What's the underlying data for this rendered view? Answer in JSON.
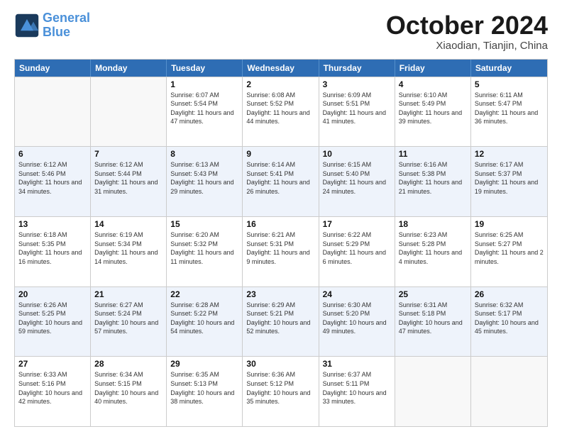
{
  "header": {
    "logo_line1": "General",
    "logo_line2": "Blue",
    "month": "October 2024",
    "location": "Xiaodian, Tianjin, China"
  },
  "days_of_week": [
    "Sunday",
    "Monday",
    "Tuesday",
    "Wednesday",
    "Thursday",
    "Friday",
    "Saturday"
  ],
  "rows": [
    {
      "alt": false,
      "cells": [
        {
          "day": "",
          "info": ""
        },
        {
          "day": "",
          "info": ""
        },
        {
          "day": "1",
          "info": "Sunrise: 6:07 AM\nSunset: 5:54 PM\nDaylight: 11 hours and 47 minutes."
        },
        {
          "day": "2",
          "info": "Sunrise: 6:08 AM\nSunset: 5:52 PM\nDaylight: 11 hours and 44 minutes."
        },
        {
          "day": "3",
          "info": "Sunrise: 6:09 AM\nSunset: 5:51 PM\nDaylight: 11 hours and 41 minutes."
        },
        {
          "day": "4",
          "info": "Sunrise: 6:10 AM\nSunset: 5:49 PM\nDaylight: 11 hours and 39 minutes."
        },
        {
          "day": "5",
          "info": "Sunrise: 6:11 AM\nSunset: 5:47 PM\nDaylight: 11 hours and 36 minutes."
        }
      ]
    },
    {
      "alt": true,
      "cells": [
        {
          "day": "6",
          "info": "Sunrise: 6:12 AM\nSunset: 5:46 PM\nDaylight: 11 hours and 34 minutes."
        },
        {
          "day": "7",
          "info": "Sunrise: 6:12 AM\nSunset: 5:44 PM\nDaylight: 11 hours and 31 minutes."
        },
        {
          "day": "8",
          "info": "Sunrise: 6:13 AM\nSunset: 5:43 PM\nDaylight: 11 hours and 29 minutes."
        },
        {
          "day": "9",
          "info": "Sunrise: 6:14 AM\nSunset: 5:41 PM\nDaylight: 11 hours and 26 minutes."
        },
        {
          "day": "10",
          "info": "Sunrise: 6:15 AM\nSunset: 5:40 PM\nDaylight: 11 hours and 24 minutes."
        },
        {
          "day": "11",
          "info": "Sunrise: 6:16 AM\nSunset: 5:38 PM\nDaylight: 11 hours and 21 minutes."
        },
        {
          "day": "12",
          "info": "Sunrise: 6:17 AM\nSunset: 5:37 PM\nDaylight: 11 hours and 19 minutes."
        }
      ]
    },
    {
      "alt": false,
      "cells": [
        {
          "day": "13",
          "info": "Sunrise: 6:18 AM\nSunset: 5:35 PM\nDaylight: 11 hours and 16 minutes."
        },
        {
          "day": "14",
          "info": "Sunrise: 6:19 AM\nSunset: 5:34 PM\nDaylight: 11 hours and 14 minutes."
        },
        {
          "day": "15",
          "info": "Sunrise: 6:20 AM\nSunset: 5:32 PM\nDaylight: 11 hours and 11 minutes."
        },
        {
          "day": "16",
          "info": "Sunrise: 6:21 AM\nSunset: 5:31 PM\nDaylight: 11 hours and 9 minutes."
        },
        {
          "day": "17",
          "info": "Sunrise: 6:22 AM\nSunset: 5:29 PM\nDaylight: 11 hours and 6 minutes."
        },
        {
          "day": "18",
          "info": "Sunrise: 6:23 AM\nSunset: 5:28 PM\nDaylight: 11 hours and 4 minutes."
        },
        {
          "day": "19",
          "info": "Sunrise: 6:25 AM\nSunset: 5:27 PM\nDaylight: 11 hours and 2 minutes."
        }
      ]
    },
    {
      "alt": true,
      "cells": [
        {
          "day": "20",
          "info": "Sunrise: 6:26 AM\nSunset: 5:25 PM\nDaylight: 10 hours and 59 minutes."
        },
        {
          "day": "21",
          "info": "Sunrise: 6:27 AM\nSunset: 5:24 PM\nDaylight: 10 hours and 57 minutes."
        },
        {
          "day": "22",
          "info": "Sunrise: 6:28 AM\nSunset: 5:22 PM\nDaylight: 10 hours and 54 minutes."
        },
        {
          "day": "23",
          "info": "Sunrise: 6:29 AM\nSunset: 5:21 PM\nDaylight: 10 hours and 52 minutes."
        },
        {
          "day": "24",
          "info": "Sunrise: 6:30 AM\nSunset: 5:20 PM\nDaylight: 10 hours and 49 minutes."
        },
        {
          "day": "25",
          "info": "Sunrise: 6:31 AM\nSunset: 5:18 PM\nDaylight: 10 hours and 47 minutes."
        },
        {
          "day": "26",
          "info": "Sunrise: 6:32 AM\nSunset: 5:17 PM\nDaylight: 10 hours and 45 minutes."
        }
      ]
    },
    {
      "alt": false,
      "cells": [
        {
          "day": "27",
          "info": "Sunrise: 6:33 AM\nSunset: 5:16 PM\nDaylight: 10 hours and 42 minutes."
        },
        {
          "day": "28",
          "info": "Sunrise: 6:34 AM\nSunset: 5:15 PM\nDaylight: 10 hours and 40 minutes."
        },
        {
          "day": "29",
          "info": "Sunrise: 6:35 AM\nSunset: 5:13 PM\nDaylight: 10 hours and 38 minutes."
        },
        {
          "day": "30",
          "info": "Sunrise: 6:36 AM\nSunset: 5:12 PM\nDaylight: 10 hours and 35 minutes."
        },
        {
          "day": "31",
          "info": "Sunrise: 6:37 AM\nSunset: 5:11 PM\nDaylight: 10 hours and 33 minutes."
        },
        {
          "day": "",
          "info": ""
        },
        {
          "day": "",
          "info": ""
        }
      ]
    }
  ]
}
